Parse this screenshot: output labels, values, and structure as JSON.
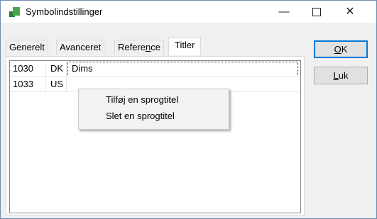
{
  "window": {
    "title": "Symbolindstillinger",
    "controls": {
      "minimize": "—",
      "close": "✕"
    }
  },
  "tabs": [
    {
      "label": "Generelt"
    },
    {
      "label": "Avanceret"
    },
    {
      "label": "Refere",
      "label_u": "n",
      "label_rest": "ce"
    },
    {
      "label": "Titler",
      "active": true
    }
  ],
  "list": {
    "rows": [
      {
        "id": "1030",
        "lang": "DK",
        "title": "Dims"
      },
      {
        "id": "1033",
        "lang": "US",
        "title": ""
      }
    ]
  },
  "context_menu": {
    "items": [
      "Tilføj en sprogtitel",
      "Slet en sprogtitel"
    ]
  },
  "buttons": {
    "ok": {
      "u": "O",
      "rest": "K"
    },
    "close": {
      "u": "L",
      "rest": "uk"
    }
  }
}
